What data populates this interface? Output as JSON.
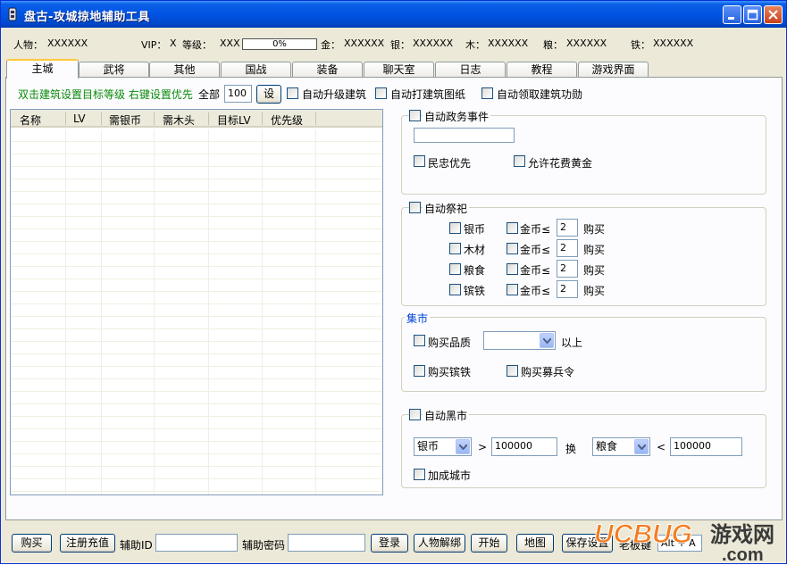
{
  "window": {
    "title": "盘古-攻城掠地辅助工具"
  },
  "info": {
    "person_label": "人物：",
    "person_value": "XXXXXX",
    "vip_label": "VIP：",
    "vip_value": "X",
    "level_label": "等级：",
    "level_value": "XXX",
    "progress_text": "0%",
    "progress_value": 0,
    "gold_label": "金：",
    "gold_value": "XXXXXX",
    "silver_label": "银：",
    "silver_value": "XXXXXX",
    "wood_label": "木：",
    "wood_value": "XXXXXX",
    "grain_label": "粮：",
    "grain_value": "XXXXXX",
    "iron_label": "铁：",
    "iron_value": "XXXXXX"
  },
  "tabs": [
    "主城",
    "武将",
    "其他",
    "国战",
    "装备",
    "聊天室",
    "日志",
    "教程",
    "游戏界面"
  ],
  "main": {
    "hint": "双击建筑设置目标等级 右键设置优先",
    "all_label": "全部",
    "all_value": "100",
    "set_button": "设",
    "auto_upgrade": "自动升级建筑",
    "auto_blueprint": "自动打建筑图纸",
    "auto_merit": "自动领取建筑功勋"
  },
  "table": {
    "columns": [
      "名称",
      "LV",
      "需银币",
      "需木头",
      "目标LV",
      "优先级"
    ],
    "rows": []
  },
  "affairs": {
    "title": "自动政务事件",
    "input_value": "",
    "loyalty": "民忠优先",
    "allow_gold": "允许花费黄金"
  },
  "sacrifice": {
    "title": "自动祭祀",
    "rows": [
      {
        "name": "银币",
        "gold_label": "金币≤",
        "value": "2",
        "buy": "购买"
      },
      {
        "name": "木材",
        "gold_label": "金币≤",
        "value": "2",
        "buy": "购买"
      },
      {
        "name": "粮食",
        "gold_label": "金币≤",
        "value": "2",
        "buy": "购买"
      },
      {
        "name": "镔铁",
        "gold_label": "金币≤",
        "value": "2",
        "buy": "购买"
      }
    ]
  },
  "market": {
    "title": "集市",
    "buy_quality": "购买品质",
    "quality_value": "",
    "above": "以上",
    "buy_iron": "购买镔铁",
    "buy_recruit": "购买募兵令"
  },
  "blackmarket": {
    "title": "自动黑市",
    "from_resource": "银币",
    "gt": ">",
    "from_value": "100000",
    "exchange": "换",
    "to_resource": "粮食",
    "lt": "<",
    "to_value": "100000",
    "rebuild_city": "加成城市"
  },
  "bottom": {
    "buy": "购买",
    "register": "注册充值",
    "id_label": "辅助ID",
    "id_value": "",
    "pwd_label": "辅助密码",
    "pwd_value": "",
    "login": "登录",
    "unbind": "人物解绑",
    "start": "开始",
    "map": "地图",
    "save": "保存设置",
    "boss_key_label": "老板键",
    "boss_key_value": "Alt + A"
  },
  "watermark": {
    "brand": "UCBUG",
    "site": "游戏网",
    "domain": ".com"
  },
  "colors": {
    "titlebar": "#0054e3",
    "accent_green": "#0a8a0a",
    "group_blue": "#0046d5"
  }
}
